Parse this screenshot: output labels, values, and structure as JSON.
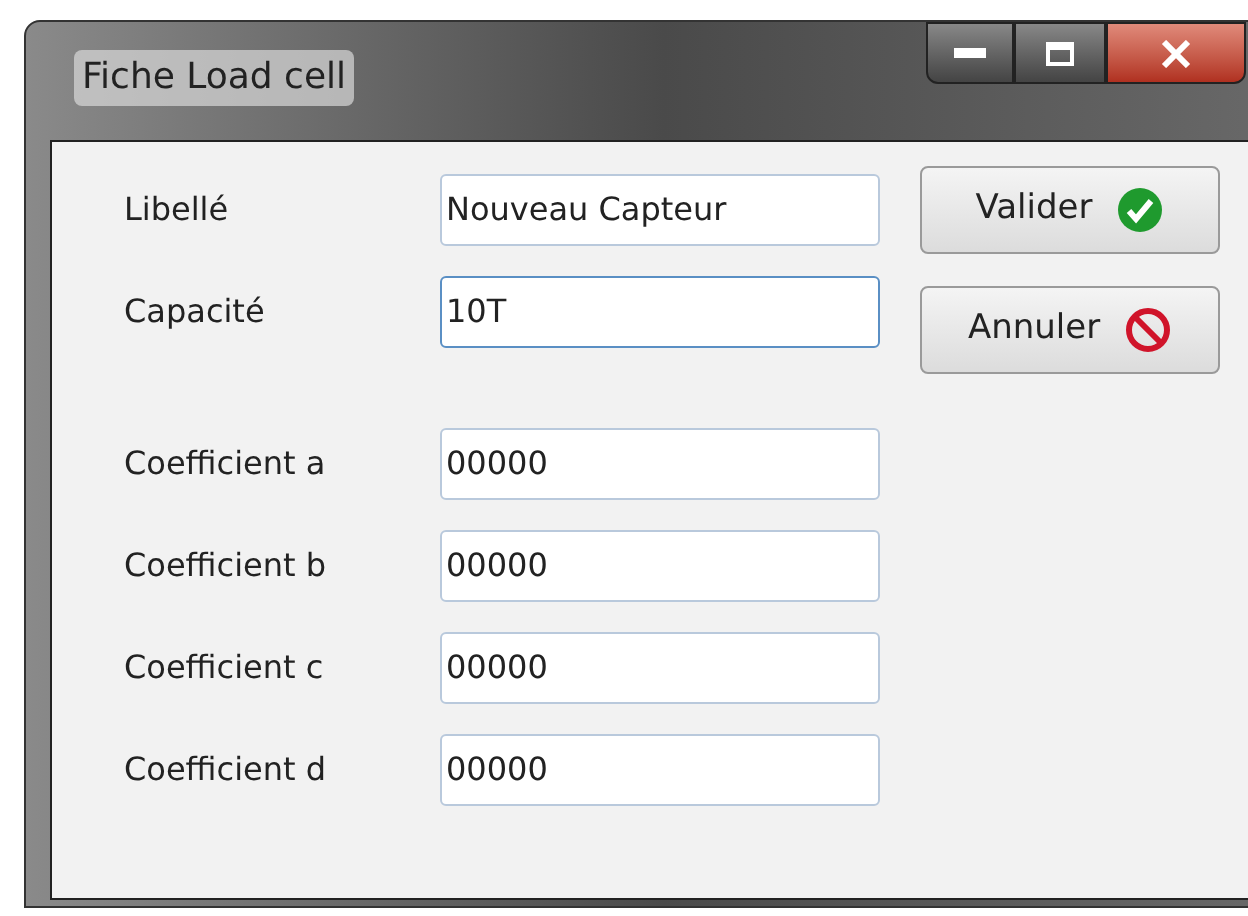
{
  "window": {
    "title": "Fiche Load cell"
  },
  "fields": [
    {
      "label": "Libellé",
      "value": "Nouveau Capteur",
      "focused": false
    },
    {
      "label": "Capacité",
      "value": "10T",
      "focused": true
    },
    {
      "label": "Coefficient a",
      "value": "00000",
      "focused": false
    },
    {
      "label": "Coefficient b",
      "value": "00000",
      "focused": false
    },
    {
      "label": "Coefficient c",
      "value": "00000",
      "focused": false
    },
    {
      "label": "Coefficient d",
      "value": "00000",
      "focused": false
    }
  ],
  "buttons": [
    {
      "label": "Valider",
      "kind": "ok"
    },
    {
      "label": "Annuler",
      "kind": "cancel"
    }
  ]
}
